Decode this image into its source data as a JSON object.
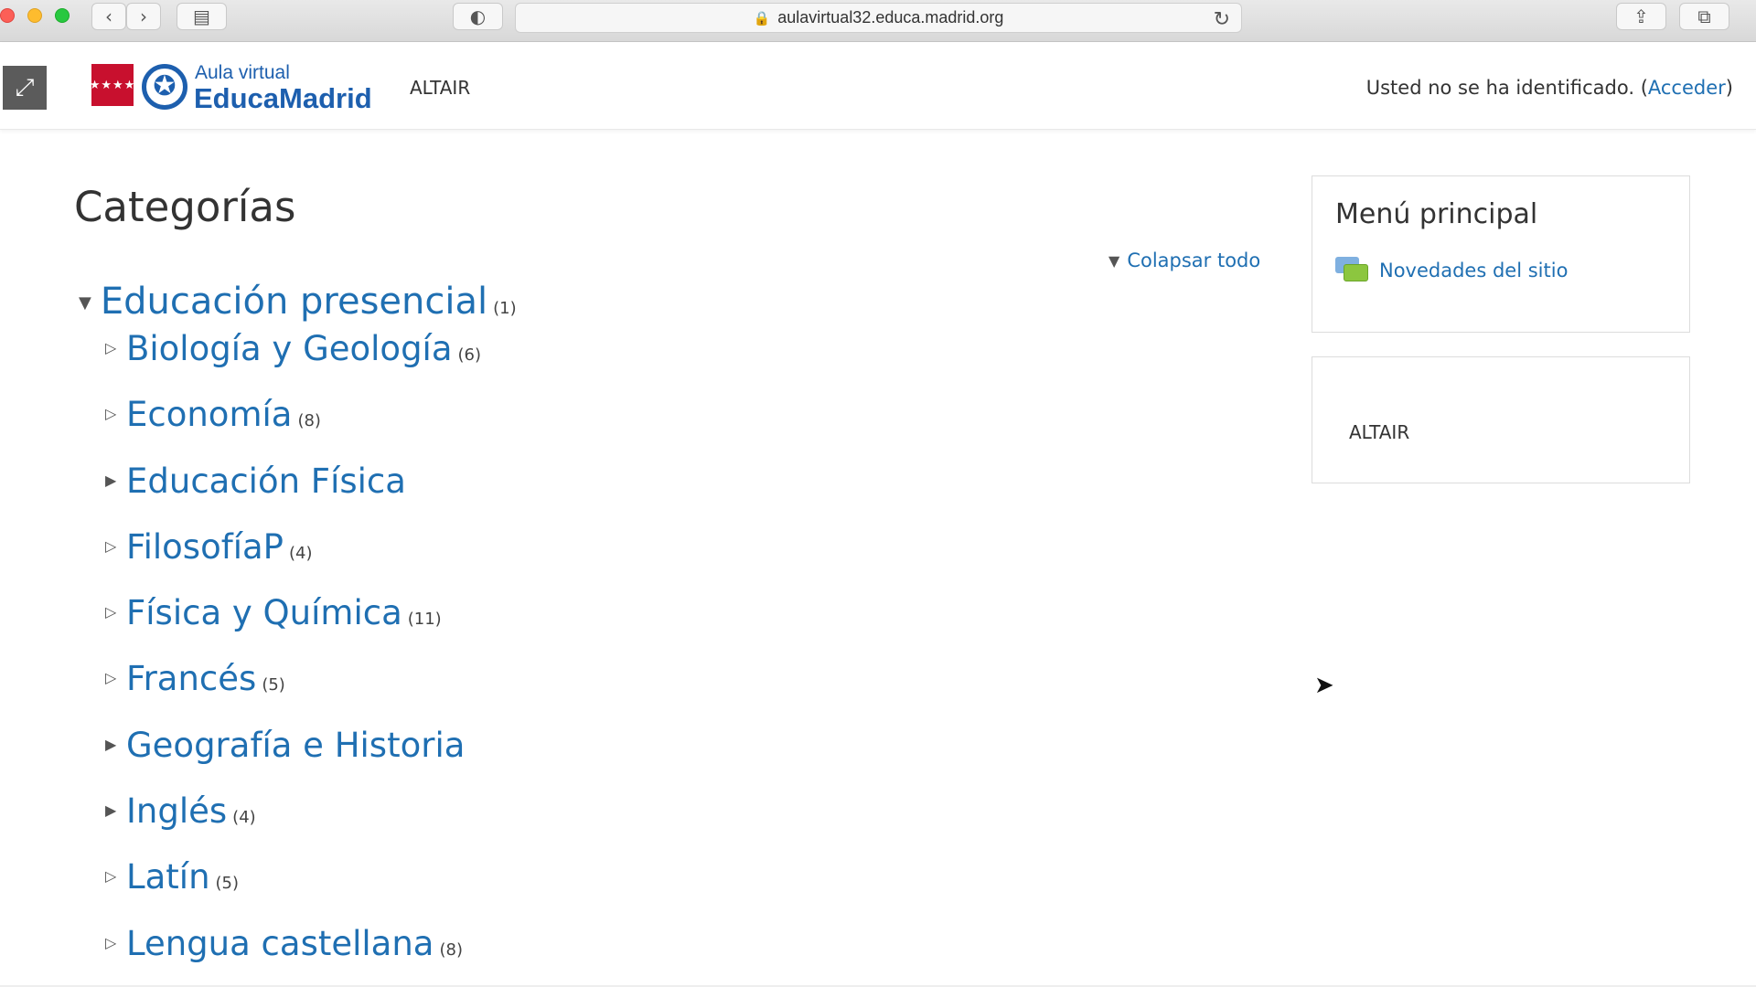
{
  "browser": {
    "url": "aulavirtual32.educa.madrid.org",
    "icons": [
      "back-icon",
      "forward-icon",
      "sidebar-icon",
      "shield-icon",
      "lock-icon",
      "reload-icon",
      "share-icon",
      "tabs-icon"
    ]
  },
  "header": {
    "logo_flag": "★★★★",
    "logo_line1": "Aula virtual",
    "logo_line2": "EducaMadrid",
    "site_name": "ALTAIR",
    "login_text": "Usted no se ha identificado. (",
    "login_link": "Acceder",
    "login_close": ")"
  },
  "main": {
    "title": "Categorías",
    "collapse_all": "Colapsar todo",
    "top_category": {
      "name": "Educación presencial",
      "count": "(1)"
    },
    "categories": [
      {
        "name": "Biología y Geología",
        "count": "(6)"
      },
      {
        "name": "Economía",
        "count": "(8)"
      },
      {
        "name": "Educación Física",
        "count": ""
      },
      {
        "name": "FilosofíaP",
        "count": "(4)"
      },
      {
        "name": "Física y Química",
        "count": "(11)"
      },
      {
        "name": "Francés",
        "count": "(5)"
      },
      {
        "name": "Geografía e Historia",
        "count": ""
      },
      {
        "name": "Inglés",
        "count": "(4)"
      },
      {
        "name": "Latín",
        "count": "(5)"
      },
      {
        "name": "Lengua castellana",
        "count": "(8)"
      }
    ]
  },
  "sidebar": {
    "main_menu_title": "Menú principal",
    "news_link": "Novedades del sitio",
    "altair_block_text": "ALTAIR"
  },
  "colors": {
    "link": "#1f6fb2",
    "brand_blue": "#1d5fae",
    "brand_red": "#c8102e"
  }
}
